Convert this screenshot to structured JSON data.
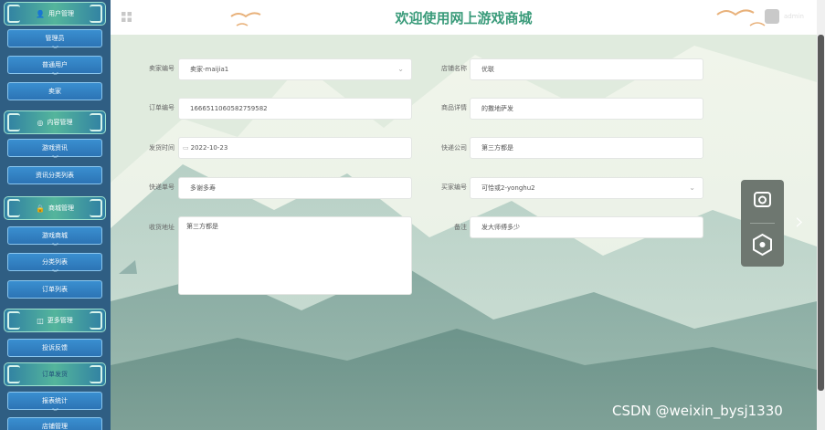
{
  "header": {
    "title": "欢迎使用网上游戏商城",
    "user_name": "admin"
  },
  "sidebar": {
    "groups": [
      {
        "label": "用户管理",
        "icon": "user-icon",
        "items": [
          "管理员",
          "普通用户",
          "卖家"
        ]
      },
      {
        "label": "内容管理",
        "icon": "content-icon",
        "items": [
          "游戏资讯",
          "资讯分类列表"
        ]
      },
      {
        "label": "商城管理",
        "icon": "shop-icon",
        "items": [
          "游戏商城",
          "分类列表",
          "订单列表"
        ]
      },
      {
        "label": "更多管理",
        "icon": "more-icon",
        "items": [
          "投诉反馈"
        ]
      },
      {
        "label": "订单发货",
        "icon": "",
        "items": [
          "报表统计",
          "店铺管理"
        ]
      }
    ]
  },
  "form": {
    "seller_id": {
      "label": "卖家编号",
      "value": "卖家-maijia1"
    },
    "shop_name": {
      "label": "店铺名称",
      "value": "优联"
    },
    "order_no": {
      "label": "订单编号",
      "value": "1666511060582759582"
    },
    "product_detail": {
      "label": "商品详情",
      "value": "的撒地萨发"
    },
    "ship_time": {
      "label": "发货时间",
      "value": "2022-10-23"
    },
    "courier": {
      "label": "快递公司",
      "value": "第三方都是"
    },
    "tracking_no": {
      "label": "快递单号",
      "value": "多谢多寿"
    },
    "buyer_id": {
      "label": "买家编号",
      "value": "可恰或2-yonghu2"
    },
    "receive_addr": {
      "label": "收货地址",
      "value": "第三方都是"
    },
    "remark": {
      "label": "备注",
      "value": "发大师傅多少"
    }
  },
  "watermark": "CSDN @weixin_bysj1330",
  "colors": {
    "sidebar_bg": "#2f5e83",
    "accent": "#3a9b7a",
    "menu_item": "#2c74b5"
  }
}
